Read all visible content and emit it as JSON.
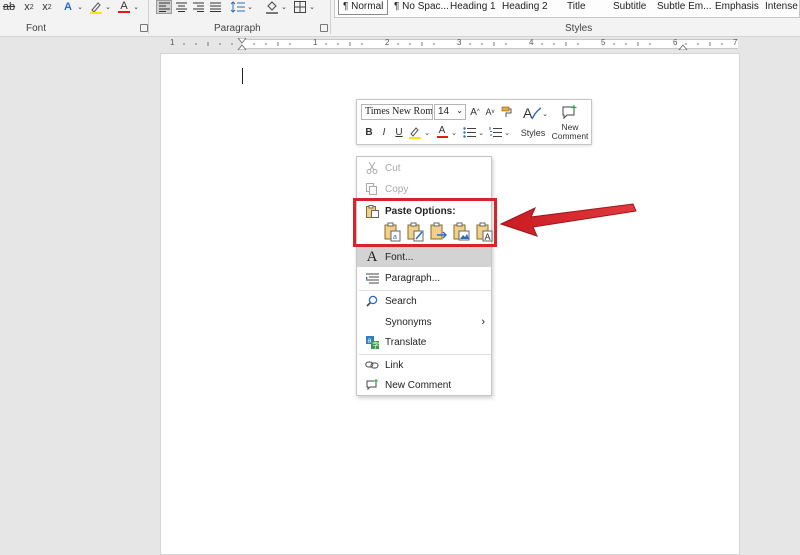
{
  "ribbon": {
    "font_group_label": "Font",
    "paragraph_group_label": "Paragraph",
    "styles_group_label": "Styles",
    "styles": [
      "¶ Normal",
      "¶ No Spac...",
      "Heading 1",
      "Heading 2",
      "Title",
      "Subtitle",
      "Subtle Em...",
      "Emphasis",
      "Intense E"
    ]
  },
  "ruler": {
    "numbers": [
      "1",
      "1",
      "2",
      "3",
      "4",
      "5",
      "6",
      "7"
    ]
  },
  "mini_toolbar": {
    "font_name": "Times New Rom",
    "font_size": "14",
    "styles_label": "Styles",
    "new_comment_label_1": "New",
    "new_comment_label_2": "Comment",
    "bold": "B",
    "italic": "I",
    "underline": "U",
    "grow": "A",
    "shrink": "A"
  },
  "context_menu": {
    "cut": "Cut",
    "copy": "Copy",
    "paste_options": "Paste Options:",
    "font": "Font...",
    "paragraph": "Paragraph...",
    "search": "Search",
    "synonyms": "Synonyms",
    "translate": "Translate",
    "link": "Link",
    "new_comment": "New Comment"
  },
  "colors": {
    "highlight": "#d8232a",
    "arrow": "#d8232a"
  }
}
